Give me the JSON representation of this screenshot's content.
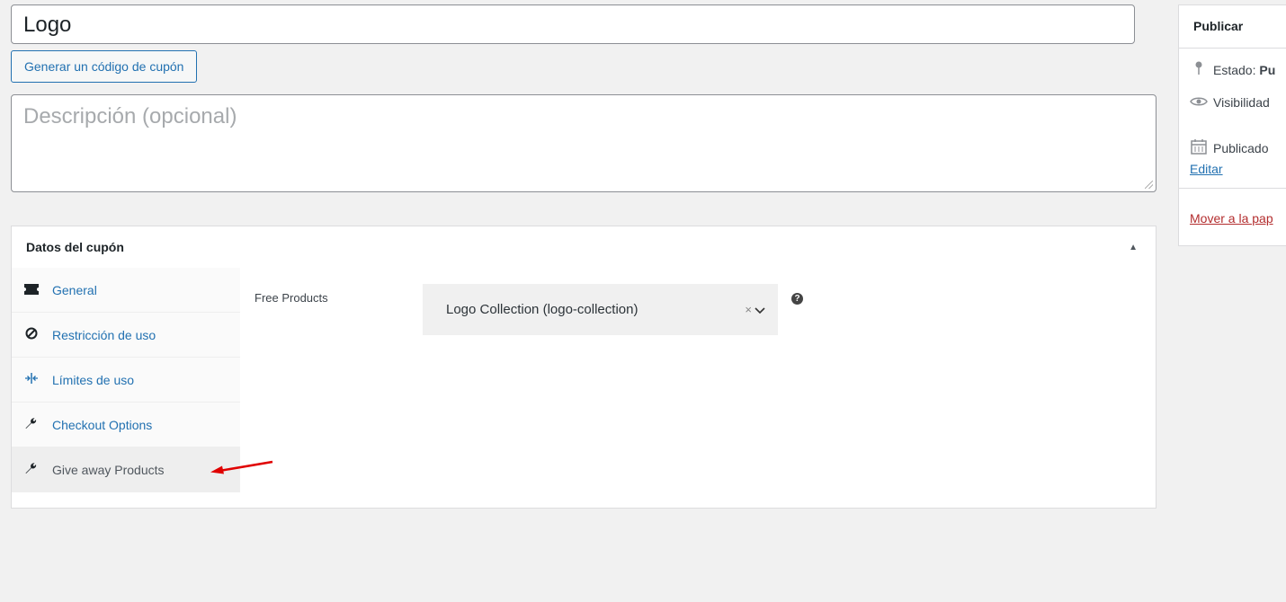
{
  "coupon": {
    "title": "Logo",
    "generate_button": "Generar un código de cupón",
    "description_placeholder": "Descripción (opcional)"
  },
  "coupon_data": {
    "heading": "Datos del cupón",
    "tabs": [
      {
        "label": "General",
        "icon": "ticket-icon"
      },
      {
        "label": "Restricción de uso",
        "icon": "blocked-icon"
      },
      {
        "label": "Límites de uso",
        "icon": "limits-icon"
      },
      {
        "label": "Checkout Options",
        "icon": "wrench-icon"
      },
      {
        "label": "Give away Products",
        "icon": "wrench-icon",
        "active": true
      }
    ],
    "free_products_label": "Free Products",
    "free_products_value": "Logo Collection (logo-collection)"
  },
  "publish": {
    "title": "Publicar",
    "status_label": "Estado:",
    "status_value": "Pu",
    "visibility_label": "Visibilidad",
    "published_label": "Publicado",
    "edit_link": "Editar",
    "trash_link": "Mover a la pap"
  },
  "colors": {
    "link": "#2271b1",
    "trash": "#b32d2e",
    "annotation_arrow": "#e00000"
  }
}
